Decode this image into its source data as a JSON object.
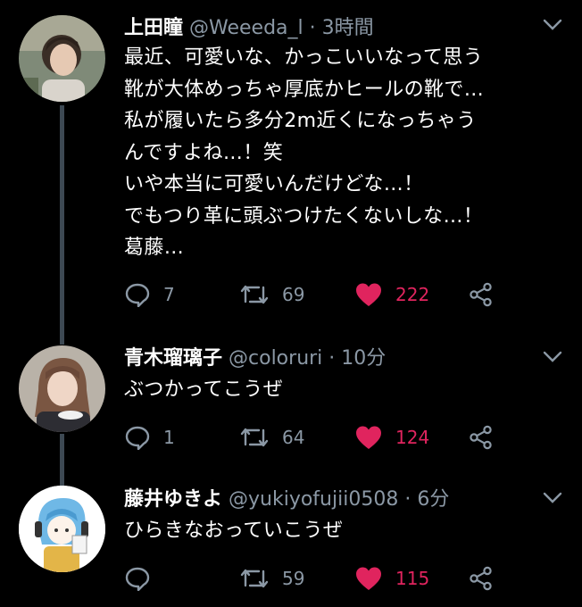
{
  "colors": {
    "background": "#000000",
    "muted": "#8b98a5",
    "like": "#e0245e",
    "thread_line": "#3d4953"
  },
  "tweets": [
    {
      "name": "上田瞳",
      "handle": "@Weeeda_l",
      "time": "3時間",
      "text": "最近、可愛いな、かっこいいなって思う\n靴が大体めっちゃ厚底かヒールの靴で…\n私が履いたら多分2m近くになっちゃう\nんですよね…！笑\nいや本当に可愛いんだけどな…！\nでもつり革に頭ぶつけたくないしな…！\n葛藤…",
      "replies": "7",
      "retweets": "69",
      "likes": "222",
      "liked": true
    },
    {
      "name": "青木瑠璃子",
      "handle": "@coloruri",
      "time": "10分",
      "text": "ぶつかってこうぜ",
      "replies": "1",
      "retweets": "64",
      "likes": "124",
      "liked": true
    },
    {
      "name": "藤井ゆきよ",
      "handle": "@yukiyofujii0508",
      "time": "6分",
      "text": "ひらきなおっていこうぜ",
      "replies": "",
      "retweets": "59",
      "likes": "115",
      "liked": true
    }
  ]
}
